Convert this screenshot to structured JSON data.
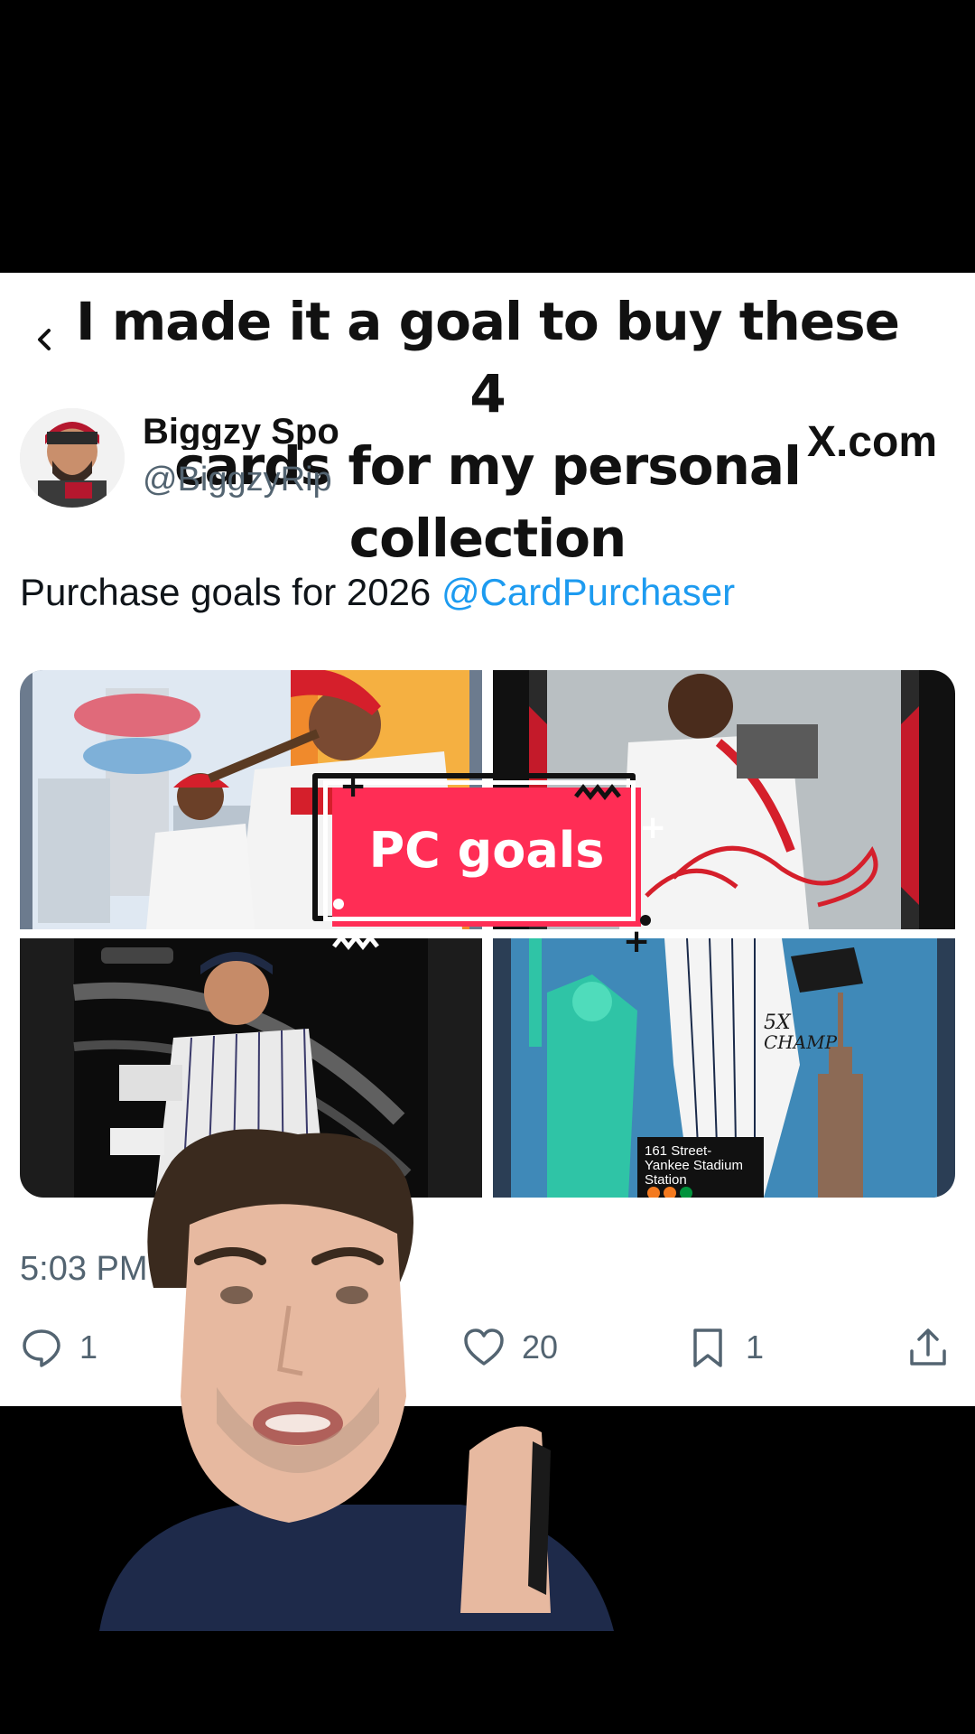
{
  "caption": {
    "line1": "I made it a goal to buy these 4",
    "line2": "cards for my personal",
    "line3": "collection"
  },
  "tweet": {
    "author_name": "Biggzy Spo",
    "author_handle": "@BiggzyRip",
    "brand": "X.com",
    "text": "Purchase goals for 2026",
    "mention": "@CardPurchaser",
    "timestamp": "5:03 PM · 1/1",
    "replies": "1",
    "likes": "20",
    "bookmarks": "1"
  },
  "sticker": {
    "label": "PC goals",
    "color": "#ff2d55"
  },
  "media": {
    "images": [
      {
        "alt": "griffey-reds-card"
      },
      {
        "alt": "griffey-autograph-card"
      },
      {
        "alt": "yankees-chrome-black-card"
      },
      {
        "alt": "jeter-liberty-card",
        "texts": [
          "5X CHAMP",
          "161 Street-",
          "Yankee Stadium",
          "Station"
        ]
      }
    ]
  },
  "colors": {
    "link": "#1d9bf0",
    "muted": "#536471",
    "background": "#000000",
    "card": "#ffffff"
  },
  "icons": [
    "back-icon",
    "reply-icon",
    "heart-icon",
    "bookmark-icon",
    "share-icon"
  ]
}
